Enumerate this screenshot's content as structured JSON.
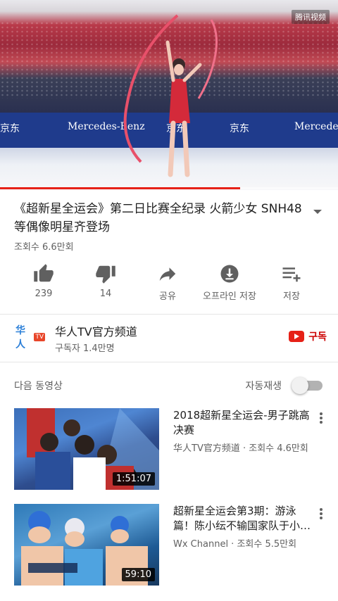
{
  "player": {
    "watermark": "腾讯视频",
    "banner_texts": [
      "京东",
      "Mercedes-Benz",
      "京东",
      "京东",
      "Mercede"
    ],
    "progress": 0.71,
    "progress_color": "#e62117"
  },
  "video": {
    "title": "《超新星全运会》第二日比赛全纪录 火箭少女 SNH48 等偶像明星齐登场",
    "views": "조회수 6.6만회"
  },
  "actions": [
    {
      "icon": "thumbs-up-icon",
      "label": "239"
    },
    {
      "icon": "thumbs-down-icon",
      "label": "14"
    },
    {
      "icon": "share-icon",
      "label": "공유"
    },
    {
      "icon": "download-icon",
      "label": "오프라인 저장"
    },
    {
      "icon": "add-to-playlist-icon",
      "label": "저장"
    }
  ],
  "channel": {
    "logo_text": "华人",
    "logo_badge": "TV",
    "name": "华人TV官方频道",
    "subscribers": "구독자 1.4만명",
    "subscribe_label": "구독"
  },
  "upnext": {
    "label": "다음 동영상",
    "autoplay_label": "자동재생",
    "autoplay_on": false
  },
  "videos": [
    {
      "title": "2018超新星全运会-男子跳高决赛",
      "meta": "华人TV官方频道 · 조회수 4.6만회",
      "duration": "1:51:07"
    },
    {
      "title": "超新星全运会第3期：游泳篇！陈小纭不输国家队于小…",
      "meta": "Wx Channel · 조회수 5.5만회",
      "duration": "59:10"
    }
  ],
  "colors": {
    "accent": "#e62117",
    "subscribe": "#cc0000",
    "text_secondary": "#606060"
  }
}
